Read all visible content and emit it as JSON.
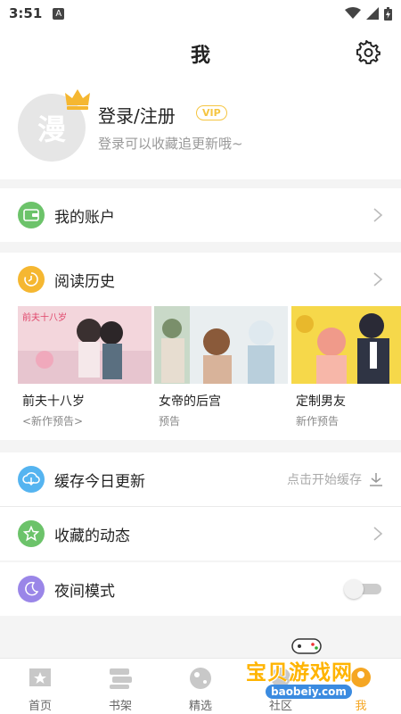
{
  "statusbar": {
    "time": "3:51",
    "badge": "A"
  },
  "header": {
    "title": "我"
  },
  "profile": {
    "avatar_text": "漫",
    "login_label": "登录/注册",
    "vip_badge": "VIP",
    "subtitle": "登录可以收藏追更新哦~"
  },
  "menu": {
    "account": {
      "label": "我的账户"
    },
    "history": {
      "label": "阅读历史"
    },
    "cache": {
      "label": "缓存今日更新",
      "action": "点击开始缓存"
    },
    "favorites": {
      "label": "收藏的动态"
    },
    "night": {
      "label": "夜间模式",
      "enabled": false
    }
  },
  "history_items": [
    {
      "title": "前夫十八岁",
      "subtitle": "<新作预告>",
      "cover_text": "前夫十八岁"
    },
    {
      "title": "女帝的后宫",
      "subtitle": "预告"
    },
    {
      "title": "定制男友",
      "subtitle": "新作预告"
    }
  ],
  "tabs": [
    {
      "label": "首页"
    },
    {
      "label": "书架"
    },
    {
      "label": "精选"
    },
    {
      "label": "社区"
    },
    {
      "label": "我",
      "active": true
    }
  ],
  "watermark": {
    "text": "宝贝游戏网",
    "url": "baobeiy.com"
  },
  "colors": {
    "accent": "#f5a623",
    "green": "#6cc36a",
    "blue": "#55b4f0",
    "purple": "#9a86e8"
  }
}
